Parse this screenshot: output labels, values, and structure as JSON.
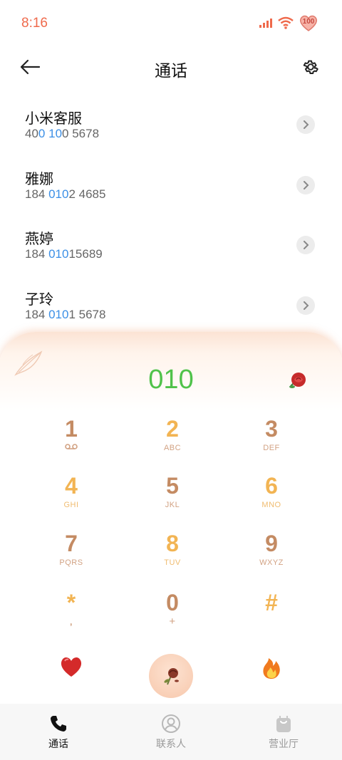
{
  "status": {
    "time": "8:16",
    "battery": "100"
  },
  "header": {
    "title": "通话"
  },
  "contacts": [
    {
      "name": "小米客服",
      "num_pre": "40",
      "num_hl1": "0",
      "num_mid": " ",
      "num_hl2": "10",
      "num_post": "0 5678"
    },
    {
      "name": "雅娜",
      "num_pre": "184 ",
      "num_hl1": "010",
      "num_mid": "",
      "num_hl2": "",
      "num_post": "2 4685"
    },
    {
      "name": "燕婷",
      "num_pre": "184 ",
      "num_hl1": "010",
      "num_mid": "",
      "num_hl2": "",
      "num_post": "15689"
    },
    {
      "name": "子玲",
      "num_pre": "184 ",
      "num_hl1": "010",
      "num_mid": "",
      "num_hl2": "",
      "num_post": "1 5678"
    }
  ],
  "dialer": {
    "input": "010",
    "keys": [
      {
        "digit": "1",
        "sub": ""
      },
      {
        "digit": "2",
        "sub": "ABC"
      },
      {
        "digit": "3",
        "sub": "DEF"
      },
      {
        "digit": "4",
        "sub": "GHI"
      },
      {
        "digit": "5",
        "sub": "JKL"
      },
      {
        "digit": "6",
        "sub": "MNO"
      },
      {
        "digit": "7",
        "sub": "PQRS"
      },
      {
        "digit": "8",
        "sub": "TUV"
      },
      {
        "digit": "9",
        "sub": "WXYZ"
      },
      {
        "digit": "*",
        "sub": ","
      },
      {
        "digit": "0",
        "sub": "+"
      },
      {
        "digit": "#",
        "sub": ""
      }
    ]
  },
  "tabs": [
    {
      "label": "通话"
    },
    {
      "label": "联系人"
    },
    {
      "label": "营业厅"
    }
  ],
  "colors": {
    "accent_blue": "#3b8fe6",
    "dial_green": "#4fc24a",
    "key_brown": "#c48b63",
    "key_gold": "#f2b453"
  }
}
